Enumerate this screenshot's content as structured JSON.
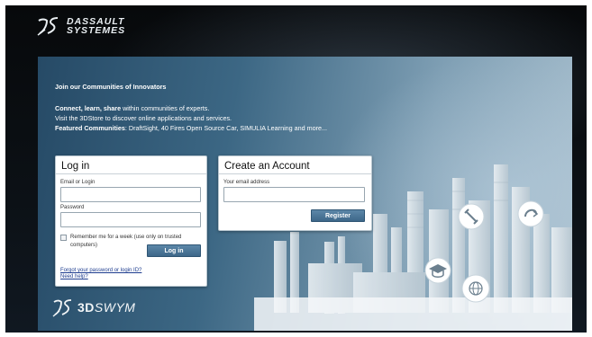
{
  "header": {
    "brand_line1": "DASSAULT",
    "brand_line2": "SYSTEMES"
  },
  "promo": {
    "title": "Join our Communities of Innovators",
    "line1_bold": "Connect, learn, share",
    "line1_rest": " within communities of experts.",
    "line2": "Visit the 3DStore to discover online applications and services.",
    "line3_bold": "Featured Communities",
    "line3_rest": ": DraftSight, 40 Fires Open Source Car, SIMULIA Learning and more..."
  },
  "login": {
    "title": "Log in",
    "email_label": "Email or Login",
    "email_value": "",
    "password_label": "Password",
    "password_value": "",
    "remember_label": "Remember me for a week (use only on trusted computers)",
    "button": "Log in",
    "forgot_link": "Forgot your password or login ID?",
    "help_link": "Need help?"
  },
  "register": {
    "title": "Create an Account",
    "email_label": "Your email address",
    "email_value": "",
    "button": "Register"
  },
  "footer": {
    "brand_3d": "3D",
    "brand_name": "SWYM"
  },
  "colors": {
    "button": "#4a7597",
    "link": "#1e3d8f",
    "panel": "#3c6784"
  },
  "icons": [
    "ds-logo-icon",
    "connect-icon",
    "share-icon",
    "graduation-cap-icon",
    "globe-icon"
  ]
}
